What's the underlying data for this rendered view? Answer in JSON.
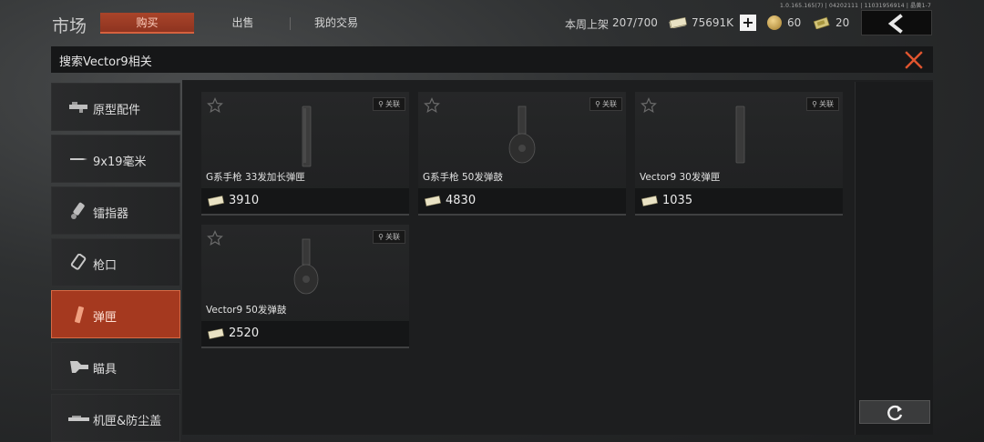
{
  "version_text": "1.0.165.165(7) | 04202111 | 11031956914 | 晶黄1-7",
  "header": {
    "title": "市场",
    "tabs": [
      {
        "label": "购买",
        "active": true
      },
      {
        "label": "出售",
        "active": false
      },
      {
        "label": "我的交易",
        "active": false
      }
    ],
    "weekly_listing_label": "本周上架",
    "weekly_listing_value": "207/700",
    "cash_value": "75691K",
    "coin_value": "60",
    "ticket_value": "20",
    "back_icon": "chevron-left-icon",
    "add_icon": "plus-icon"
  },
  "search": {
    "title": "搜索Vector9相关",
    "close_icon": "close-icon"
  },
  "sidebar": {
    "items": [
      {
        "label": "原型配件",
        "icon": "prototype-part-icon",
        "active": false
      },
      {
        "label": "9x19毫米",
        "icon": "ammo-icon",
        "active": false
      },
      {
        "label": "镭指器",
        "icon": "laser-icon",
        "active": false
      },
      {
        "label": "枪口",
        "icon": "muzzle-icon",
        "active": false
      },
      {
        "label": "弹匣",
        "icon": "magazine-icon",
        "active": true
      },
      {
        "label": "瞄具",
        "icon": "scope-icon",
        "active": false
      },
      {
        "label": "机匣&防尘盖",
        "icon": "receiver-icon",
        "active": false
      }
    ]
  },
  "items": [
    {
      "name": "G系手枪 33发加长弹匣",
      "price": "3910",
      "link_label": "关联",
      "kind": "long"
    },
    {
      "name": "G系手枪 50发弹鼓",
      "price": "4830",
      "link_label": "关联",
      "kind": "drum"
    },
    {
      "name": "Vector9 30发弹匣",
      "price": "1035",
      "link_label": "关联",
      "kind": "long"
    },
    {
      "name": "Vector9 50发弹鼓",
      "price": "2520",
      "link_label": "关联",
      "kind": "drum"
    }
  ],
  "refresh_icon": "refresh-icon",
  "colors": {
    "accent": "#a5391f",
    "accent_border": "#d86a45",
    "close": "#e0552f"
  }
}
